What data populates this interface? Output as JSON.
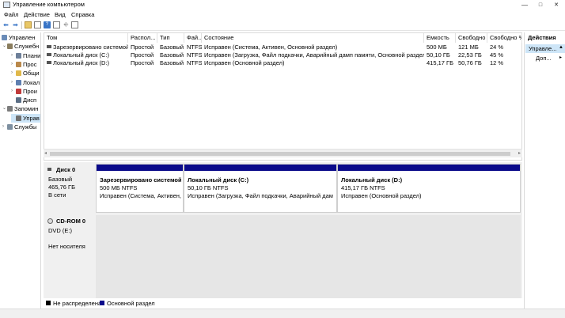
{
  "window": {
    "title": "Управление компьютером",
    "min": "—",
    "max": "□",
    "close": "✕"
  },
  "menu": [
    "Файл",
    "Действие",
    "Вид",
    "Справка"
  ],
  "toolbar": [
    "back-arrow-icon",
    "forward-arrow-icon",
    "up-folder-icon",
    "properties-icon",
    "help-icon",
    "console-icon",
    "view-icon"
  ],
  "tree": [
    {
      "label": "Управлен",
      "expander": "",
      "depth": 0,
      "icon": "computer-icon",
      "color": "#6b8cb8"
    },
    {
      "label": "Служебн",
      "expander": "⌄",
      "depth": 1,
      "icon": "tools-icon",
      "color": "#8a7d5e"
    },
    {
      "label": "Плани",
      "expander": "›",
      "depth": 2,
      "icon": "scheduler-icon",
      "color": "#6d7f99"
    },
    {
      "label": "Прос",
      "expander": "›",
      "depth": 2,
      "icon": "event-viewer-icon",
      "color": "#b9884a"
    },
    {
      "label": "Общи",
      "expander": "›",
      "depth": 2,
      "icon": "shared-folders-icon",
      "color": "#e0b84a"
    },
    {
      "label": "Локал",
      "expander": "›",
      "depth": 2,
      "icon": "users-icon",
      "color": "#5f7fb0"
    },
    {
      "label": "Прои",
      "expander": "›",
      "depth": 2,
      "icon": "performance-icon",
      "color": "#c03a3a"
    },
    {
      "label": "Дисп",
      "expander": "",
      "depth": 2,
      "icon": "device-manager-icon",
      "color": "#5b6e85"
    },
    {
      "label": "Запомин",
      "expander": "⌄",
      "depth": 1,
      "icon": "storage-icon",
      "color": "#7c7c7c"
    },
    {
      "label": "Управ",
      "expander": "",
      "depth": 2,
      "icon": "disk-management-icon",
      "color": "#6f6f6f",
      "selected": true
    },
    {
      "label": "Службы",
      "expander": "›",
      "depth": 1,
      "icon": "services-icon",
      "color": "#7d8fa0"
    }
  ],
  "volumes": {
    "columns": [
      "Том",
      "Распол...",
      "Тип",
      "Фай...",
      "Состояние",
      "Емкость",
      "Свободно",
      "Свободно %"
    ],
    "rows": [
      [
        "Зарезервировано системой",
        "Простой",
        "Базовый",
        "NTFS",
        "Исправен (Система, Активен, Основной раздел)",
        "500 МБ",
        "121 МБ",
        "24 %"
      ],
      [
        "Локальный диск (C:)",
        "Простой",
        "Базовый",
        "NTFS",
        "Исправен (Загрузка, Файл подкачки, Аварийный дамп памяти, Основной раздел)",
        "50,10 ГБ",
        "22,53 ГБ",
        "45 %"
      ],
      [
        "Локальный диск (D:)",
        "Простой",
        "Базовый",
        "NTFS",
        "Исправен (Основной раздел)",
        "415,17 ГБ",
        "50,76 ГБ",
        "12 %"
      ]
    ]
  },
  "disk0": {
    "name": "Диск 0",
    "type": "Базовый",
    "size": "465,76 ГБ",
    "status": "В сети",
    "partitions": [
      {
        "title": "Зарезервировано системой",
        "size": "500 МБ NTFS",
        "status": "Исправен (Система, Активен, О"
      },
      {
        "title": "Локальный диск  (C:)",
        "size": "50,10 ГБ NTFS",
        "status": "Исправен (Загрузка, Файл подкачки, Аварийный дам"
      },
      {
        "title": "Локальный диск  (D:)",
        "size": "415,17 ГБ NTFS",
        "status": "Исправен (Основной раздел)"
      }
    ]
  },
  "cdrom": {
    "name": "CD-ROM 0",
    "type": "DVD (E:)",
    "status": "Нет носителя"
  },
  "legend": [
    {
      "label": "Не распределена",
      "color": "#000000"
    },
    {
      "label": "Основной раздел",
      "color": "#0a0a8a"
    }
  ],
  "actions": {
    "header": "Действия",
    "selected": "Управле...",
    "arrow": "▲",
    "item": "Доп...",
    "item_arrow": "▸"
  },
  "colors": {
    "partition_bar": "#0a0a8a",
    "selection": "#cde5f7",
    "panel_bg": "#f0f0f0"
  }
}
